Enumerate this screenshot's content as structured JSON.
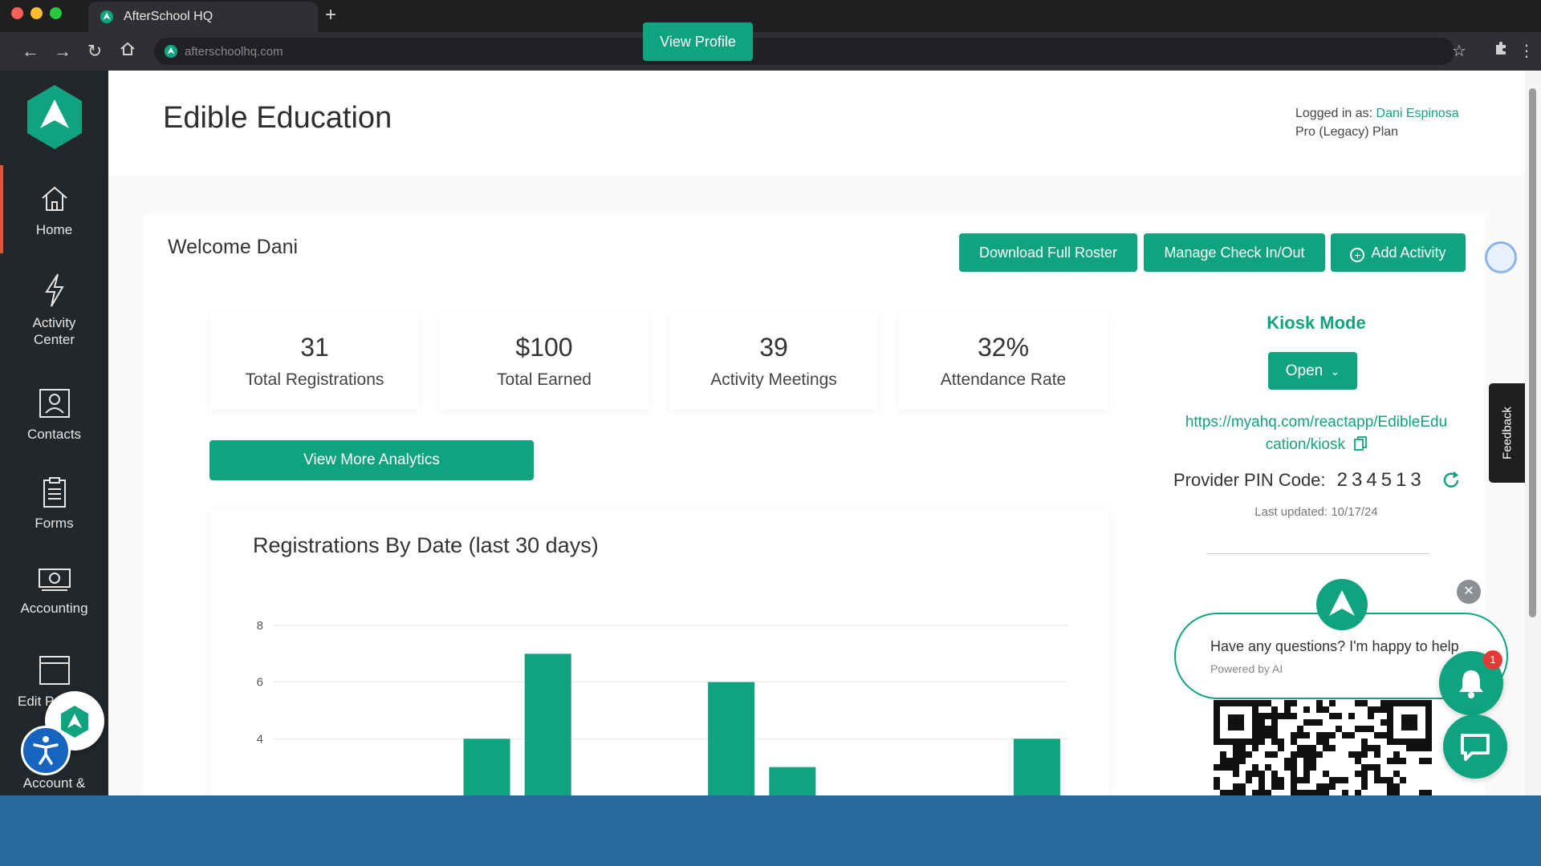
{
  "browser": {
    "tab_title": "AfterSchool HQ",
    "url": "afterschoolhq.com"
  },
  "sidebar": {
    "items": [
      {
        "label": "Home",
        "icon": "home-icon"
      },
      {
        "label": "Activity Center",
        "icon": "lightning-icon"
      },
      {
        "label": "Contacts",
        "icon": "contacts-icon"
      },
      {
        "label": "Forms",
        "icon": "clipboard-icon"
      },
      {
        "label": "Accounting",
        "icon": "cash-icon"
      },
      {
        "label": "Edit P",
        "icon": "browser-window-icon"
      },
      {
        "label": "Account &",
        "icon": "account-icon"
      }
    ]
  },
  "header": {
    "title": "Edible Education",
    "view_profile_label": "View Profile",
    "logged_in_prefix": "Logged in as:",
    "user_name": "Dani Espinosa",
    "plan": "Pro (Legacy) Plan"
  },
  "dashboard": {
    "welcome": "Welcome Dani",
    "download_roster_label": "Download Full Roster",
    "manage_checkin_label": "Manage Check In/Out",
    "add_activity_label": "Add Activity",
    "stats": [
      {
        "value": "31",
        "label": "Total Registrations"
      },
      {
        "value": "$100",
        "label": "Total Earned"
      },
      {
        "value": "39",
        "label": "Activity Meetings"
      },
      {
        "value": "32%",
        "label": "Attendance Rate"
      }
    ],
    "analytics_label": "View More Analytics"
  },
  "chart_data": {
    "type": "bar",
    "title": "Registrations By Date (last 30 days)",
    "ylim": [
      2,
      8
    ],
    "yticks": [
      "8",
      "6",
      "4"
    ],
    "values": [
      0,
      0,
      0,
      4,
      7,
      0,
      0,
      6,
      3,
      0,
      0,
      0,
      4
    ]
  },
  "kiosk": {
    "title": "Kiosk Mode",
    "open_label": "Open",
    "url_line1": "https://myahq.com/reactapp/EdibleEdu",
    "url_line2": "cation/kiosk",
    "pin_label": "Provider PIN Code:",
    "pin_code": "234513",
    "last_updated": "Last updated: 10/17/24"
  },
  "feedback_label": "Feedback",
  "chat": {
    "message": "Have any questions? I'm happy to help",
    "powered_by": "Powered by AI",
    "badge_count": "1"
  },
  "colors": {
    "accent": "#10a37f",
    "sidebar": "#24272a",
    "bottom_band": "#2b6aa0"
  }
}
